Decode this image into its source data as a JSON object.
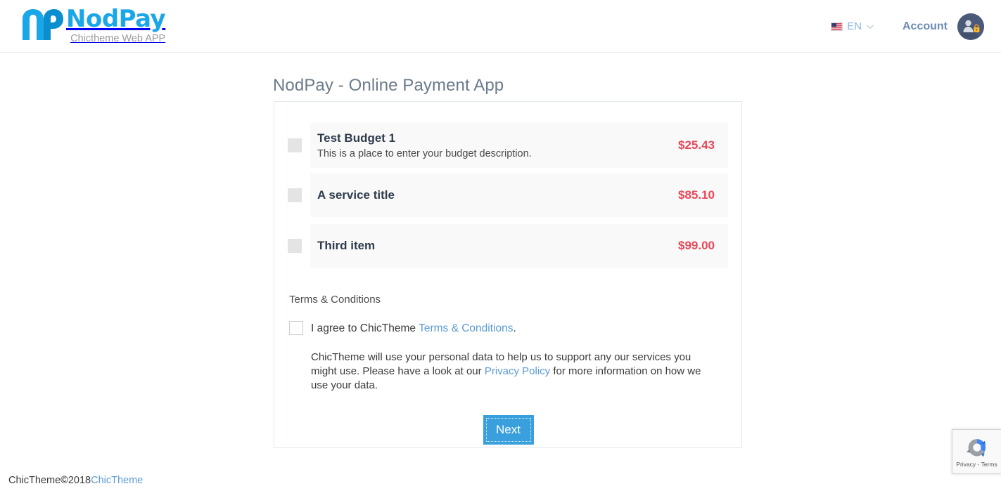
{
  "header": {
    "brand_name": "NodPay",
    "brand_tagline": "Chictheme Web APP",
    "language": "EN",
    "account_label": "Account",
    "flag_icon": "us-flag-icon",
    "chevron_icon": "chevron-down-icon",
    "avatar_icon": "user-lock-avatar-icon",
    "accent_color": "#1aa7e8"
  },
  "main": {
    "page_title": "NodPay - Online Payment App",
    "items": [
      {
        "title": "Test Budget 1",
        "description": "This is a place to enter your budget description.",
        "price": "$25.43"
      },
      {
        "title": "A service title",
        "description": "",
        "price": "$85.10"
      },
      {
        "title": "Third item",
        "description": "",
        "price": "$99.00"
      }
    ],
    "terms": {
      "heading": "Terms & Conditions",
      "agree_prefix": "I agree to ChicTheme ",
      "agree_link": "Terms & Conditions",
      "agree_suffix": ".",
      "privacy_prefix": "ChicTheme will use your personal data to help us to support any our services you might use. Please have a look at our ",
      "privacy_link": "Privacy Policy",
      "privacy_suffix": " for more information on how we use your data."
    },
    "next_label": "Next",
    "price_color": "#e8485a",
    "button_color": "#39a0dd"
  },
  "footer": {
    "text_before": "ChicTheme ",
    "copyright_symbol": "©",
    "year": " 2018 ",
    "link_label": "ChicTheme"
  },
  "recaptcha": {
    "label": "Privacy - Terms",
    "logo_icon": "recaptcha-logo-icon"
  }
}
